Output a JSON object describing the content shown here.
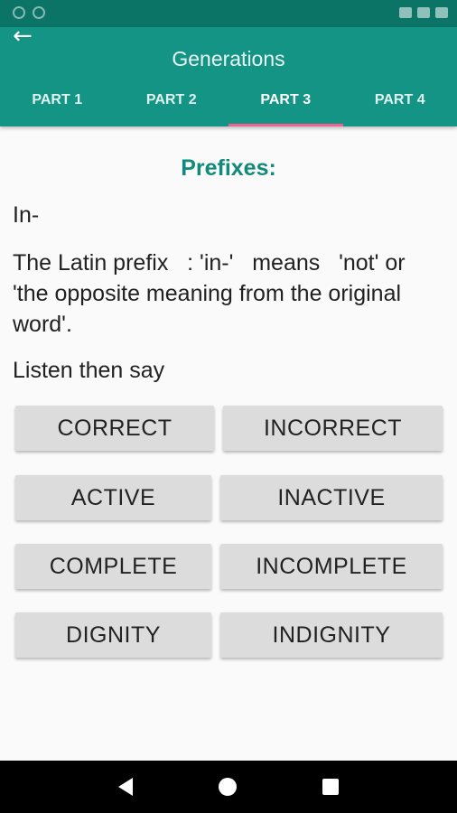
{
  "app_bar": {
    "title": "Generations",
    "back_icon": "←",
    "tabs": [
      {
        "label": "PART 1",
        "active": false
      },
      {
        "label": "PART 2",
        "active": false
      },
      {
        "label": "PART 3",
        "active": true
      },
      {
        "label": "PART 4",
        "active": false
      }
    ]
  },
  "colors": {
    "app_bar": "#149485",
    "status_bar": "#0b7466",
    "heading": "#128a7b",
    "tab_indicator": "#f06292",
    "button": "#dcdcdc"
  },
  "content": {
    "heading": "Prefixes:",
    "prefix": "In-",
    "description": "The Latin prefix   : 'in-'   means   'not' or 'the opposite meaning from the original word'.",
    "instruction": "Listen then say"
  },
  "words": [
    {
      "left": "CORRECT",
      "right": "INCORRECT"
    },
    {
      "left": "ACTIVE",
      "right": "INACTIVE"
    },
    {
      "left": "COMPLETE",
      "right": "INCOMPLETE"
    },
    {
      "left": "DIGNITY",
      "right": "INDIGNITY"
    }
  ],
  "nav": {
    "back_icon": "triangle-back",
    "home_icon": "circle-home",
    "recent_icon": "square-recents"
  }
}
